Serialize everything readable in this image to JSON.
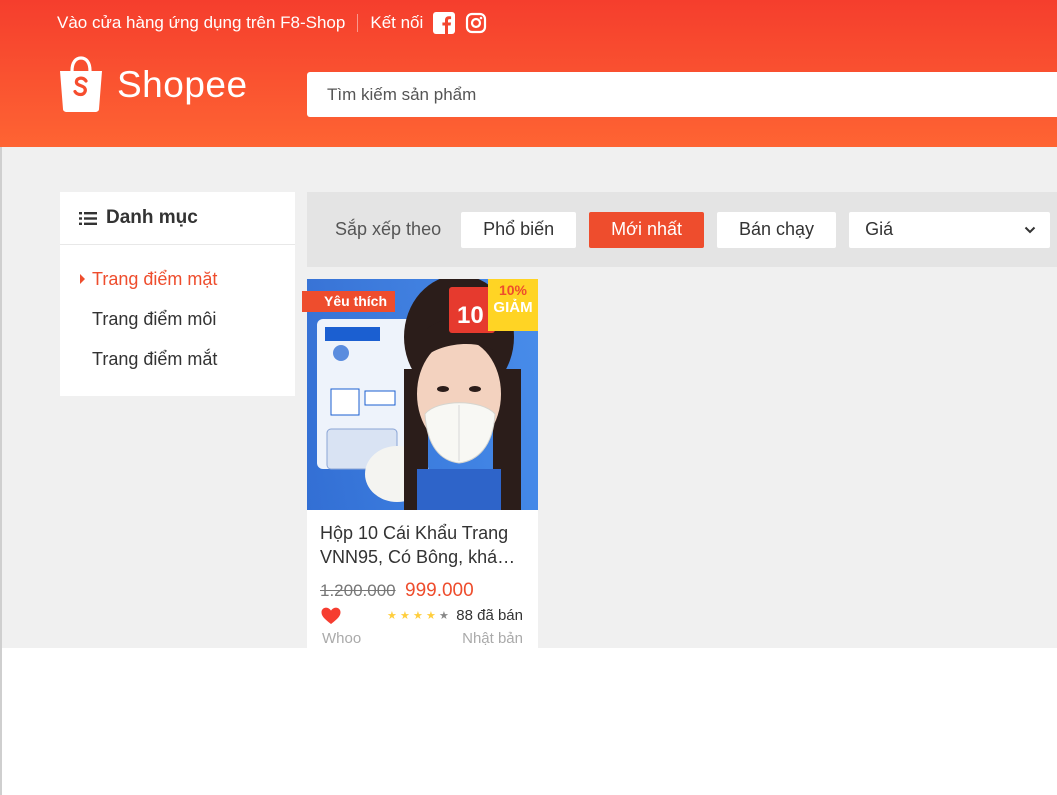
{
  "header": {
    "download_text": "Vào cửa hàng ứng dụng trên F8-Shop",
    "connect_text": "Kết nối",
    "logo_text": "Shopee",
    "search_placeholder": "Tìm kiếm sản phẩm"
  },
  "sidebar": {
    "title": "Danh mục",
    "items": [
      {
        "label": "Trang điểm mặt",
        "active": true
      },
      {
        "label": "Trang điểm môi",
        "active": false
      },
      {
        "label": "Trang điểm mắt",
        "active": false
      }
    ]
  },
  "sort": {
    "label": "Sắp xếp theo",
    "popular": "Phổ biến",
    "newest": "Mới nhất",
    "best_selling": "Bán chạy",
    "price": "Giá"
  },
  "product": {
    "favorite_tag": "Yêu thích",
    "discount_percent": "10%",
    "discount_label": "GIẢM",
    "name_line1": "Hộp 10 Cái Khẩu Trang",
    "name_line2": "VNN95, Có Bông, kháng...",
    "old_price": "1.200.000",
    "new_price": "999.000",
    "rating": 4,
    "rating_max": 5,
    "sold": "88 đã bán",
    "brand": "Whoo",
    "origin": "Nhật bản"
  },
  "colors": {
    "brand": "#ee4d2d",
    "header_top": "#f53e2d",
    "header_bottom": "#fe6433",
    "star": "#ffce3d"
  }
}
